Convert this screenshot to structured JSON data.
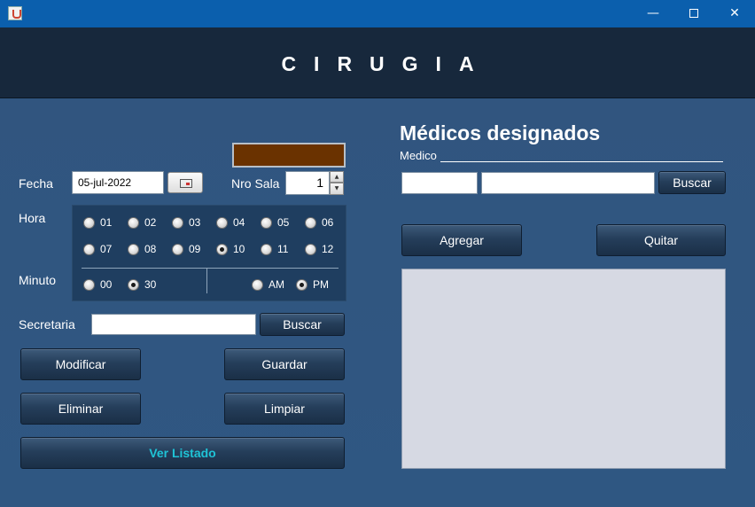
{
  "window": {
    "minimize_glyph": "—",
    "close_glyph": "✕"
  },
  "header": {
    "title": "CIRUGIA"
  },
  "form": {
    "fecha_label": "Fecha",
    "fecha_value": "05-jul-2022",
    "nro_sala_label": "Nro Sala",
    "nro_sala_value": "1",
    "color_swatch": "#6a3200",
    "hora_label": "Hora",
    "minuto_label": "Minuto",
    "hours": [
      "01",
      "02",
      "03",
      "04",
      "05",
      "06",
      "07",
      "08",
      "09",
      "10",
      "11",
      "12"
    ],
    "selected_hour": "10",
    "minutes": [
      "00",
      "30"
    ],
    "selected_minute": "30",
    "ampm": [
      "AM",
      "PM"
    ],
    "selected_ampm": "PM",
    "secretaria_label": "Secretaria",
    "secretaria_value": "",
    "buscar_label": "Buscar",
    "modificar_label": "Modificar",
    "guardar_label": "Guardar",
    "eliminar_label": "Eliminar",
    "limpiar_label": "Limpiar",
    "ver_listado_label": "Ver Listado"
  },
  "medicos": {
    "title": "Médicos designados",
    "medico_label": "Medico",
    "field1_value": "",
    "field2_value": "",
    "buscar_label": "Buscar",
    "agregar_label": "Agregar",
    "quitar_label": "Quitar",
    "list_items": []
  },
  "colors": {
    "panel_bg": "#2f5680",
    "header_bg": "#17283c",
    "titlebar_bg": "#0b5fad",
    "accent_cyan": "#1fc3d6"
  }
}
